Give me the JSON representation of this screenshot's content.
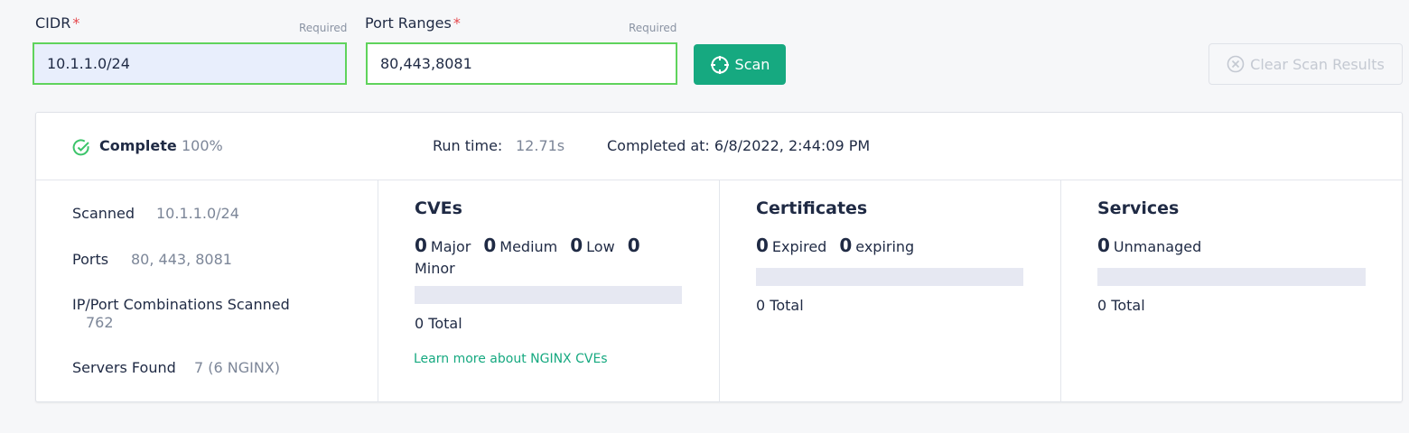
{
  "form": {
    "cidr_label": "CIDR",
    "cidr_required": "Required",
    "cidr_value": "10.1.1.0/24",
    "ports_label": "Port Ranges",
    "ports_required": "Required",
    "ports_value": "80,443,8081",
    "required_star": "*",
    "scan_label": "Scan",
    "clear_label": "Clear Scan Results"
  },
  "status": {
    "state": "Complete",
    "percent": "100%",
    "run_time_label": "Run time:",
    "run_time_value": "12.71s",
    "completed_at": "Completed at: 6/8/2022, 2:44:09 PM"
  },
  "summary": {
    "scanned_label": "Scanned",
    "scanned_value": "10.1.1.0/24",
    "ports_label": "Ports",
    "ports_value": "80, 443, 8081",
    "combos_label": "IP/Port Combinations Scanned",
    "combos_value": "762",
    "servers_label": "Servers Found",
    "servers_value": "7 (6 NGINX)"
  },
  "cves": {
    "title": "CVEs",
    "major_count": "0",
    "major_label": "Major",
    "medium_count": "0",
    "medium_label": "Medium",
    "low_count": "0",
    "low_label": "Low",
    "minor_count": "0",
    "minor_label": "Minor",
    "total": "0 Total",
    "learn_more": "Learn more about NGINX CVEs"
  },
  "certificates": {
    "title": "Certificates",
    "expired_count": "0",
    "expired_label": "Expired",
    "expiring_count": "0",
    "expiring_label": "expiring",
    "total": "0 Total"
  },
  "services": {
    "title": "Services",
    "unmanaged_count": "0",
    "unmanaged_label": "Unmanaged",
    "total": "0 Total"
  },
  "colors": {
    "accent": "#16a980",
    "valid_border": "#5fd35c",
    "required_star": "#e5484d"
  },
  "icons": {
    "scan": "crosshair-icon",
    "clear": "circle-x-icon",
    "complete": "check-circle-icon"
  }
}
